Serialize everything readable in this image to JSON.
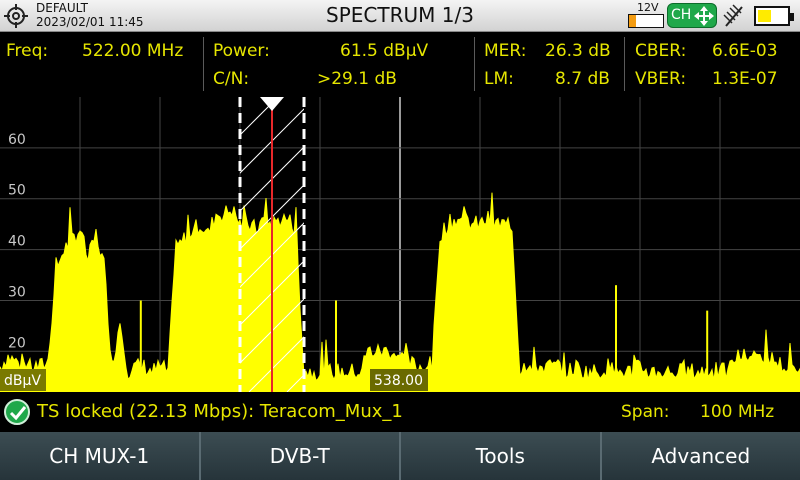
{
  "header": {
    "profile": "DEFAULT",
    "datetime": "2023/02/01 11:45",
    "title": "SPECTRUM 1/3",
    "voltage": "12V",
    "ch_badge": "CH",
    "icons": [
      "crosshair-icon",
      "move-arrows-icon",
      "antenna-icon",
      "battery-icon"
    ],
    "battery_level": 0.4,
    "power_output_level": 0.2
  },
  "measurements": {
    "freq_label": "Freq:",
    "freq_value": "522.00 MHz",
    "power_label": "Power:",
    "power_value": "61.5 dBµV",
    "cn_label": "C/N:",
    "cn_value": ">29.1 dB",
    "mer_label": "MER:",
    "mer_value": "26.3 dB",
    "lm_label": "LM:",
    "lm_value": "8.7 dB",
    "cber_label": "CBER:",
    "cber_value": "6.6E-03",
    "vber_label": "VBER:",
    "vber_value": "1.3E-07"
  },
  "spectrum": {
    "y_ticks": [
      "60",
      "50",
      "40",
      "30",
      "20"
    ],
    "unit_label": "dBµV",
    "center_label": "538.00",
    "colors": {
      "trace": "#ffff00",
      "marker": "#e8282a",
      "grid": "#444444",
      "text": "#e6e600"
    }
  },
  "chart_data": {
    "type": "area",
    "xlabel": "",
    "ylabel": "dBµV",
    "x_center_mhz": 538.0,
    "span_mhz": 100,
    "x_range_mhz": [
      488,
      588
    ],
    "ylim": [
      12,
      70
    ],
    "y_ticks": [
      20,
      30,
      40,
      50,
      60
    ],
    "marker_freq_mhz": 522.0,
    "channel_band_mhz": [
      518.0,
      526.0
    ],
    "grid": true,
    "series": [
      {
        "x": [
          488,
          489,
          490,
          491,
          492,
          493,
          494,
          495,
          496,
          497,
          498,
          499,
          500,
          501,
          502,
          503,
          504,
          505,
          506,
          507,
          508,
          509,
          510,
          511,
          512,
          513,
          514,
          515,
          516,
          517,
          518,
          519,
          520,
          521,
          522,
          523,
          524,
          525,
          526,
          527,
          528,
          529,
          530,
          531,
          532,
          533,
          534,
          535,
          536,
          537,
          538,
          539,
          540,
          541,
          542,
          543,
          544,
          545,
          546,
          547,
          548,
          549,
          550,
          551,
          552,
          553,
          554,
          555,
          556,
          557,
          558,
          559,
          560,
          561,
          562,
          563,
          564,
          565,
          566,
          567,
          568,
          569,
          570,
          571,
          572,
          573,
          574,
          575,
          576,
          577,
          578,
          579,
          580,
          581,
          582,
          583,
          584,
          585,
          586,
          587,
          588
        ],
        "y": [
          17,
          19,
          18,
          17,
          17,
          17,
          18,
          36,
          40,
          42,
          44,
          38,
          43,
          37,
          17,
          26,
          16,
          17,
          17,
          16,
          17,
          16,
          40,
          42,
          44,
          45,
          43,
          47,
          47,
          48,
          45,
          45,
          44,
          46,
          45,
          46,
          46,
          44,
          16,
          16,
          16,
          16,
          16,
          16,
          16,
          16,
          20,
          20,
          20,
          20,
          19,
          18,
          17,
          17,
          17,
          43,
          45,
          46,
          46,
          45,
          45,
          46,
          45,
          45,
          44,
          16,
          18,
          17,
          17,
          17,
          17,
          16,
          17,
          16,
          16,
          16,
          17,
          16,
          16,
          16,
          17,
          16,
          16,
          16,
          16,
          16,
          16,
          16,
          16,
          16,
          16,
          16,
          19,
          19,
          19,
          19,
          19,
          18,
          17,
          16,
          16
        ]
      }
    ]
  },
  "status": {
    "text": "TS locked (22.13 Mbps): Teracom_Mux_1",
    "span_label": "Span:",
    "span_value": "100 MHz"
  },
  "softkeys": [
    "CH MUX-1",
    "DVB-T",
    "Tools",
    "Advanced"
  ]
}
